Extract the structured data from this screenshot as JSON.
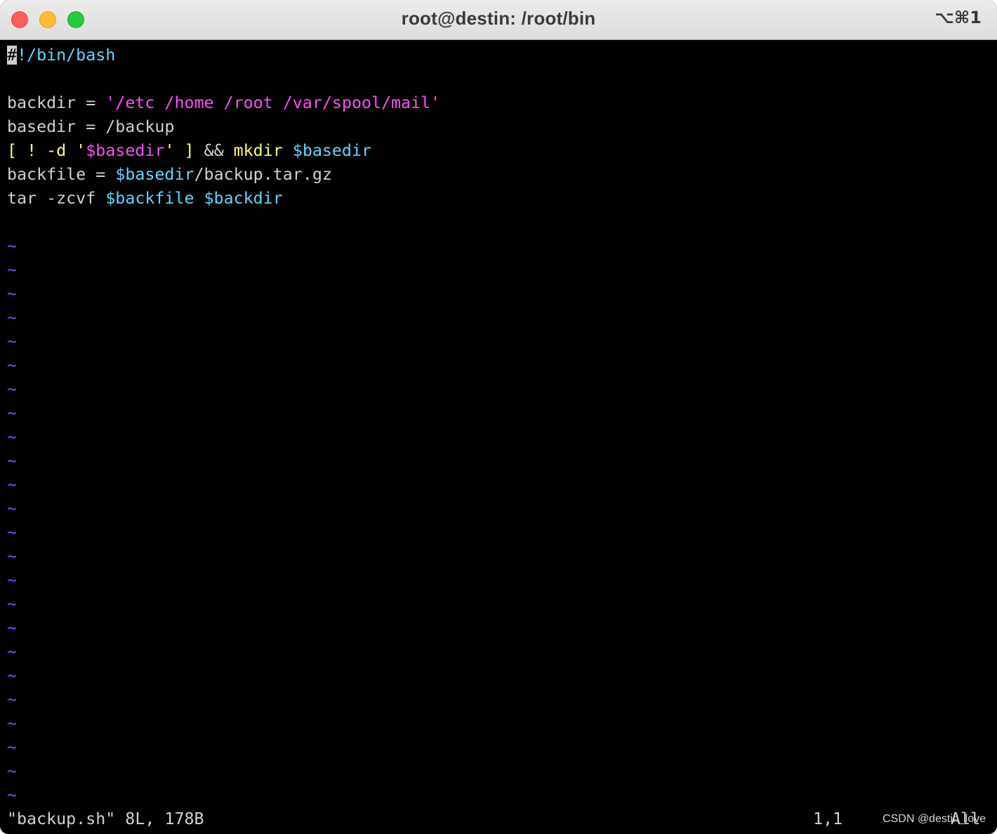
{
  "window": {
    "title": "root@destin: /root/bin",
    "shortcut": "⌥⌘1"
  },
  "editor": {
    "cursor_char": "#",
    "shebang_rest": "!/bin/bash",
    "line2": {
      "var": "backdir = ",
      "str": "'/etc /home /root /var/spool/mail'"
    },
    "line3": {
      "text": "basedir = /backup"
    },
    "line4": {
      "p1": "[ ! -d '",
      "p2": "$basedir",
      "p3": "' ]",
      "p4": " && ",
      "p5": "mkdir",
      "p6": " ",
      "p7": "$basedir"
    },
    "line5": {
      "p1": "backfile = ",
      "p2": "$basedir",
      "p3": "/backup.tar.gz"
    },
    "line6": {
      "p1": "tar -zcvf ",
      "p2": "$backfile",
      "p3": " ",
      "p4": "$backdir"
    },
    "tilde": "~"
  },
  "status": {
    "file_info": "\"backup.sh\" 8L, 178B",
    "position": "1,1",
    "scroll": "All"
  },
  "watermark": "CSDN @destin_love",
  "colors": {
    "cyan": "#5fd7ff",
    "magenta": "#ff4df8",
    "yellow": "#ffff5f",
    "tilde_blue": "#5c5cff"
  }
}
